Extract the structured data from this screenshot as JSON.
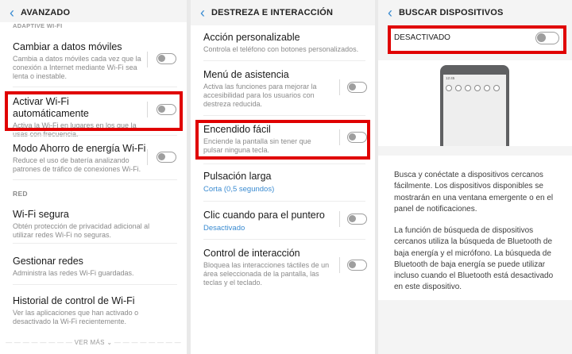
{
  "panel1": {
    "title": "AVANZADO",
    "section_adaptive": "ADAPTIVE WI-FI",
    "items": [
      {
        "title": "Cambiar a datos móviles",
        "desc": "Cambia a datos móviles cada vez que la conexión a Internet mediante Wi-Fi sea lenta o inestable."
      },
      {
        "title": "Activar Wi-Fi automáticamente",
        "desc": "Activa la Wi-Fi en lugares en los que la usas con frecuencia."
      },
      {
        "title": "Modo Ahorro de energía Wi-Fi",
        "desc": "Reduce el uso de batería analizando patrones de tráfico de conexiones Wi-Fi."
      }
    ],
    "section_red": "RED",
    "red_items": [
      {
        "title": "Wi-Fi segura",
        "desc": "Obtén protección de privacidad adicional al utilizar redes Wi-Fi no seguras."
      },
      {
        "title": "Gestionar redes",
        "desc": "Administra las redes Wi-Fi guardadas."
      },
      {
        "title": "Historial de control de Wi-Fi",
        "desc": "Ver las aplicaciones que han activado o desactivado la Wi-Fi recientemente."
      }
    ],
    "ver_mas": "VER MÁS"
  },
  "panel2": {
    "title": "DESTREZA E INTERACCIÓN",
    "items": [
      {
        "title": "Acción personalizable",
        "desc": "Controla el teléfono con botones personalizados."
      },
      {
        "title": "Menú de asistencia",
        "desc": "Activa las funciones para mejorar la accesibilidad para los usuarios con destreza reducida."
      },
      {
        "title": "Encendido fácil",
        "desc": "Enciende la pantalla sin tener que pulsar ninguna tecla."
      },
      {
        "title": "Pulsación larga",
        "sub": "Corta (0,5 segundos)"
      },
      {
        "title": "Clic cuando para el puntero",
        "sub": "Desactivado"
      },
      {
        "title": "Control de interacción",
        "desc": "Bloquea las interacciones táctiles de un área seleccionada de la pantalla, las teclas y el teclado."
      }
    ]
  },
  "panel3": {
    "title": "BUSCAR DISPOSITIVOS",
    "master_label": "DESACTIVADO",
    "phone_time": "12:45",
    "para1": "Busca y conéctate a dispositivos cercanos fácilmente. Los dispositivos disponibles se mostrarán en una ventana emergente o en el panel de notificaciones.",
    "para2": "La función de búsqueda de dispositivos cercanos utiliza la búsqueda de Bluetooth de baja energía y el micrófono. La búsqueda de Bluetooth de baja energía se puede utilizar incluso cuando el Bluetooth está desactivado en este dispositivo."
  },
  "colors": {
    "accent": "#3a8bd1",
    "highlight": "#e00000",
    "toggle": "#9e9e9e"
  },
  "icons": {
    "back": "chevron-left-icon",
    "more": "chevron-down-icon"
  }
}
